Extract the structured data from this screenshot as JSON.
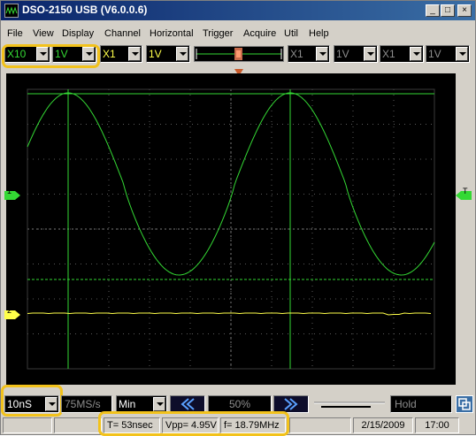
{
  "window": {
    "title": "DSO-2150 USB (V6.0.0.6)"
  },
  "titlebar": {
    "minimize_glyph": "_",
    "maximize_glyph": "□",
    "close_glyph": "×"
  },
  "menu": [
    "File",
    "View",
    "Display",
    "Channel",
    "Horizontal",
    "Trigger",
    "Acquire",
    "Util",
    "Help"
  ],
  "controls": {
    "ch1_probe": "X10",
    "ch1_volts": "1V",
    "ch2_probe": "X1",
    "ch2_volts": "1V",
    "ch3_probe": "X1",
    "ch3_volts": "1V",
    "ch4_probe": "X1",
    "ch4_volts": "1V",
    "trigger_marker": "T"
  },
  "screen": {
    "ch1_marker": "1",
    "ch2_marker": "2",
    "trigger_level_marker": "T",
    "colors": {
      "ch1": "#34d934",
      "ch2": "#ffff4a",
      "grid": "#a0a0a0",
      "background": "#000000"
    }
  },
  "bottom": {
    "timebase": "10nS",
    "sample_rate": "75MS/s",
    "mode": "Min",
    "position": "50%",
    "hold": "Hold",
    "prev_icon": "double-left-icon",
    "next_icon": "double-right-icon"
  },
  "status": {
    "period": "T= 53nsec",
    "vpp": "Vpp= 4.95V",
    "freq": "f= 18.79MHz",
    "date": "2/15/2009",
    "time": "17:00"
  }
}
